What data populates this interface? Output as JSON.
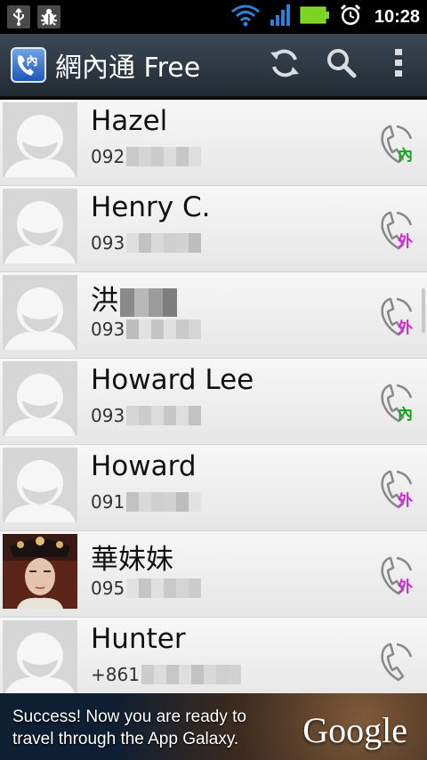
{
  "status_bar": {
    "time": "10:28",
    "icons": [
      "usb-icon",
      "debug-icon",
      "wifi-icon",
      "signal-icon",
      "battery-icon",
      "alarm-icon"
    ]
  },
  "action_bar": {
    "app_icon_glyph": "內",
    "title": "網內通 Free",
    "actions": [
      "refresh-icon",
      "search-icon",
      "overflow-menu-icon"
    ]
  },
  "contacts": [
    {
      "name": "Hazel",
      "name_redacted": false,
      "phone_prefix": "092",
      "carrier": "內",
      "carrier_type": "in",
      "avatar": "default"
    },
    {
      "name": "Henry C.",
      "name_redacted": false,
      "phone_prefix": "093",
      "carrier": "外",
      "carrier_type": "out",
      "avatar": "default"
    },
    {
      "name": "洪",
      "name_redacted": true,
      "phone_prefix": "093",
      "carrier": "外",
      "carrier_type": "out",
      "avatar": "default"
    },
    {
      "name": "Howard Lee",
      "name_redacted": false,
      "phone_prefix": "093",
      "carrier": "內",
      "carrier_type": "in",
      "avatar": "default"
    },
    {
      "name": "Howard",
      "name_redacted": false,
      "phone_prefix": "091",
      "carrier": "外",
      "carrier_type": "out",
      "avatar": "default"
    },
    {
      "name": "華妹妹",
      "name_redacted": false,
      "phone_prefix": "095",
      "carrier": "外",
      "carrier_type": "out",
      "avatar": "photo"
    },
    {
      "name": "Hunter",
      "name_redacted": false,
      "phone_prefix": "+861",
      "carrier": "",
      "carrier_type": "none",
      "avatar": "default"
    }
  ],
  "ad": {
    "text": "Success! Now you are ready to\ntravel through the App Galaxy.",
    "brand": "Google"
  },
  "colors": {
    "tag_in": "#14a31a",
    "tag_out": "#e020e0",
    "action_bar": "#2d3843"
  }
}
